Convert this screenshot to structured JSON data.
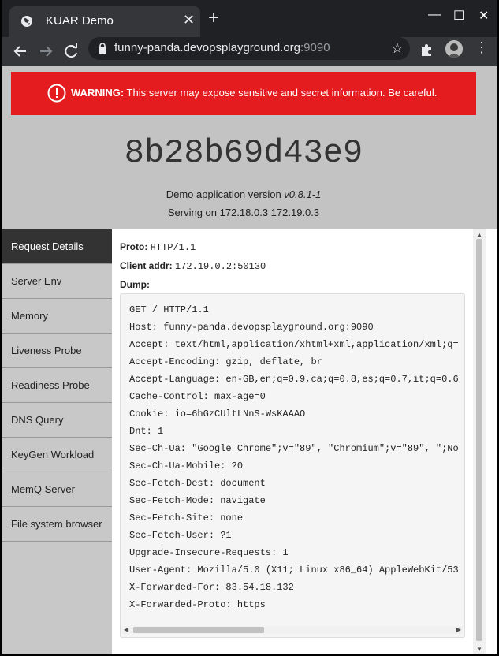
{
  "browser": {
    "tab_title": "KUAR Demo",
    "url_host": "funny-panda.devopsplayground.org",
    "url_port": ":9090"
  },
  "warning": {
    "label": "WARNING:",
    "text": " This server may expose sensitive and secret information. Be careful."
  },
  "app": {
    "hostname": "8b28b69d43e9",
    "version_prefix": "Demo application version ",
    "version": "v0.8.1-1",
    "serving": "Serving on 172.18.0.3 172.19.0.3"
  },
  "sidebar": {
    "items": [
      {
        "label": "Request Details",
        "active": true
      },
      {
        "label": "Server Env"
      },
      {
        "label": "Memory"
      },
      {
        "label": "Liveness Probe"
      },
      {
        "label": "Readiness Probe"
      },
      {
        "label": "DNS Query"
      },
      {
        "label": "KeyGen Workload"
      },
      {
        "label": "MemQ Server"
      },
      {
        "label": "File system browser"
      }
    ]
  },
  "request": {
    "proto_label": "Proto:",
    "proto_value": "HTTP/1.1",
    "client_label": "Client addr:",
    "client_value": "172.19.0.2:50130",
    "dump_label": "Dump:",
    "dump_lines": [
      "GET / HTTP/1.1",
      "Host: funny-panda.devopsplayground.org:9090",
      "Accept: text/html,application/xhtml+xml,application/xml;q=",
      "Accept-Encoding: gzip, deflate, br",
      "Accept-Language: en-GB,en;q=0.9,ca;q=0.8,es;q=0.7,it;q=0.6",
      "Cache-Control: max-age=0",
      "Cookie: io=6hGzCUltLNnS-WsKAAAO",
      "Dnt: 1",
      "Sec-Ch-Ua: \"Google Chrome\";v=\"89\", \"Chromium\";v=\"89\", \";No",
      "Sec-Ch-Ua-Mobile: ?0",
      "Sec-Fetch-Dest: document",
      "Sec-Fetch-Mode: navigate",
      "Sec-Fetch-Site: none",
      "Sec-Fetch-User: ?1",
      "Upgrade-Insecure-Requests: 1",
      "User-Agent: Mozilla/5.0 (X11; Linux x86_64) AppleWebKit/53",
      "X-Forwarded-For: 83.54.18.132",
      "X-Forwarded-Proto: https"
    ]
  },
  "icons": {
    "tab": "globe-icon",
    "warning": "alert-circle-icon",
    "lock": "lock-icon",
    "star": "star-icon",
    "extensions": "puzzle-icon"
  },
  "colors": {
    "warning_bg": "#e41b1f",
    "header_bg": "#c3c3c3",
    "sidebar_bg": "#c8c8c8",
    "sidebar_active_bg": "#333333"
  }
}
